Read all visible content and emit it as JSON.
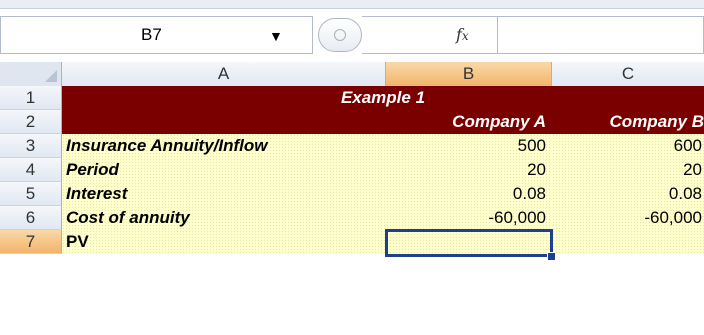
{
  "formula_bar": {
    "name_box": "B7",
    "fx_label": "fx",
    "formula": ""
  },
  "columns": [
    "A",
    "B",
    "C"
  ],
  "rows": [
    "1",
    "2",
    "3",
    "4",
    "5",
    "6",
    "7"
  ],
  "active_cell": "B7",
  "cells": {
    "title": "Example 1",
    "header_b": "Company A",
    "header_c": "Company B",
    "r3": {
      "a": "Insurance Annuity/Inflow",
      "b": "500",
      "c": "600"
    },
    "r4": {
      "a": "Period",
      "b": "20",
      "c": "20"
    },
    "r5": {
      "a": "Interest",
      "b": "0.08",
      "c": "0.08"
    },
    "r6": {
      "a": "Cost of annuity",
      "b": "-60,000",
      "c": "-60,000"
    },
    "r7": {
      "a": "PV",
      "b": "",
      "c": ""
    }
  },
  "colors": {
    "header_fill": "#7a0000",
    "data_fill": "#ffffcc",
    "active_header": "#f2b46a",
    "selection": "#1f3f8f"
  }
}
